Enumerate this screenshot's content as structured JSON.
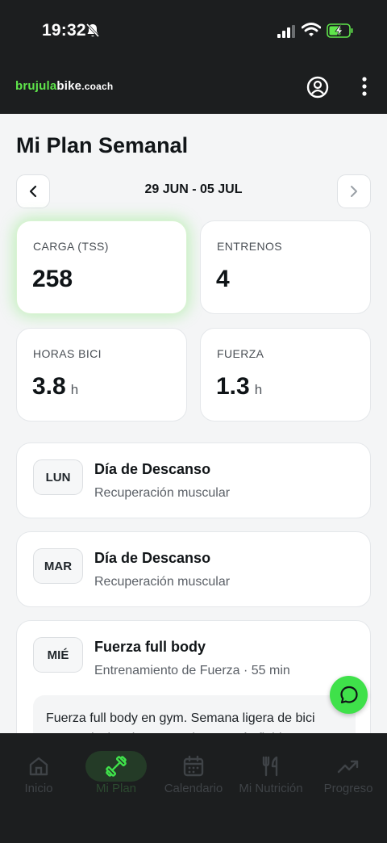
{
  "status_bar": {
    "time": "19:32"
  },
  "header": {
    "logo": {
      "part1": "brujula",
      "part2": "bike",
      "part3": ".coach"
    }
  },
  "page": {
    "title": "Mi Plan Semanal",
    "week_range": "29 JUN - 05 JUL"
  },
  "stats": [
    {
      "label": "CARGA (TSS)",
      "value": "258",
      "unit": ""
    },
    {
      "label": "ENTRENOS",
      "value": "4",
      "unit": ""
    },
    {
      "label": "HORAS BICI",
      "value": "3.8",
      "unit": "h"
    },
    {
      "label": "FUERZA",
      "value": "1.3",
      "unit": "h"
    }
  ],
  "days": [
    {
      "day": "LUN",
      "title": "Día de Descanso",
      "subtitle": "Recuperación muscular"
    },
    {
      "day": "MAR",
      "title": "Día de Descanso",
      "subtitle": "Recuperación muscular"
    },
    {
      "day": "MIÉ",
      "title": "Fuerza full body",
      "subtitle": "Entrenamiento de Fuerza · 55 min",
      "description": "Fuerza full body en gym. Semana ligera de bici para reducir volumen total y ser más fiable."
    }
  ],
  "nav": [
    {
      "label": "Inicio",
      "icon": "home-icon"
    },
    {
      "label": "Mi Plan",
      "icon": "dumbbell-icon",
      "active": true
    },
    {
      "label": "Calendario",
      "icon": "calendar-icon"
    },
    {
      "label": "Mi Nutrición",
      "icon": "utensils-icon"
    },
    {
      "label": "Progreso",
      "icon": "trending-up-icon"
    }
  ],
  "colors": {
    "accent": "#3fe14a",
    "dark": "#1c1e1f",
    "background": "#f4f5f6"
  }
}
